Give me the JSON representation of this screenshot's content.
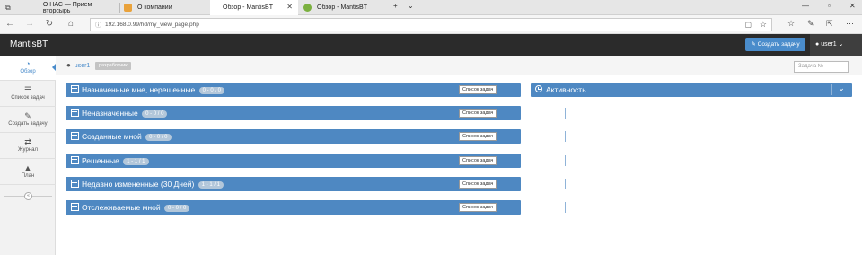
{
  "browser": {
    "tabs": [
      {
        "label": "О НАС — Прием вторсырь"
      },
      {
        "label": "О компании"
      },
      {
        "label": "Обзор - MantisBT"
      },
      {
        "label": "Обзор - MantisBT"
      }
    ],
    "url": "192.168.0.99/hd/my_view_page.php"
  },
  "navbar": {
    "brand": "MantisBT",
    "create_button": "Создать задачу",
    "user": "user1"
  },
  "sidebar": {
    "items": [
      {
        "label": "Обзор",
        "icon": "dashboard-icon"
      },
      {
        "label": "Список задач",
        "icon": "list-icon"
      },
      {
        "label": "Создать задачу",
        "icon": "edit-icon"
      },
      {
        "label": "Журнал",
        "icon": "retweet-icon"
      },
      {
        "label": "План",
        "icon": "road-icon"
      }
    ]
  },
  "breadcrumb": {
    "user": "user1",
    "role": "разработчик"
  },
  "search": {
    "placeholder": "Задача №"
  },
  "boxes": {
    "list_label": "Список задач",
    "items": [
      {
        "title": "Назначенные мне, нерешенные",
        "count": "0 - 0 / 0"
      },
      {
        "title": "Неназначенные",
        "count": "0 - 0 / 0"
      },
      {
        "title": "Созданные мной",
        "count": "0 - 0 / 0"
      },
      {
        "title": "Решенные",
        "count": "1 - 1 / 1"
      },
      {
        "title": "Недавно измененные (30 Дней)",
        "count": "1 - 1 / 1"
      },
      {
        "title": "Отслеживаемые мной",
        "count": "0 - 0 / 0"
      }
    ]
  },
  "activity": {
    "title": "Активность"
  },
  "colors": {
    "accent": "#4a8ccb",
    "box_header": "#4e88c2",
    "navbar": "#2b2b2b"
  }
}
